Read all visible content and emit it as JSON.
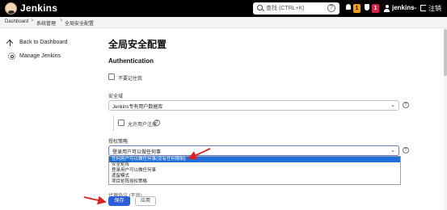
{
  "header": {
    "brand": "Jenkins",
    "search_placeholder": "查找 (CTRL+K)",
    "help_glyph": "?",
    "notification_count": "1",
    "security_count": "1",
    "username": "jenkins",
    "user_menu_glyph": "⌄",
    "logout_label": "注销"
  },
  "breadcrumb": {
    "items": [
      "Dashboard",
      "系统管理",
      "全局安全配置"
    ],
    "separator": ">"
  },
  "sidebar": {
    "items": [
      {
        "label": "Back to Dashboard",
        "icon": "arrow-up-icon"
      },
      {
        "label": "Manage Jenkins",
        "icon": "gear-icon"
      }
    ]
  },
  "main": {
    "title": "全局安全配置",
    "section": "Authentication",
    "disable_remember_me": {
      "label": "不要记住我",
      "checked": false
    },
    "security_realm": {
      "label": "安全域",
      "value": "Jenkins专有用户数据库",
      "help": "?"
    },
    "allow_signup": {
      "label": "允许用户注册",
      "checked": false,
      "help": "?"
    },
    "authorization": {
      "label": "授权策略",
      "value": "登录用户可以做任何事",
      "help": "?",
      "options": [
        "任何用户可以做任何事(没有任何限制)",
        "安全矩阵",
        "登录用户可以做任何事",
        "遗留模式",
        "项目矩阵授权策略"
      ],
      "highlighted_index": 0
    },
    "truncated_label": "代理协议 (不显)",
    "save_label": "保存",
    "apply_label": "应用"
  },
  "colors": {
    "header_bg": "#000000",
    "accent": "#2b5fd9",
    "option_highlight": "#1e6fd9",
    "annotation_arrow": "#e02020",
    "badge_orange": "#f59e0b",
    "badge_red": "#e11d48"
  }
}
